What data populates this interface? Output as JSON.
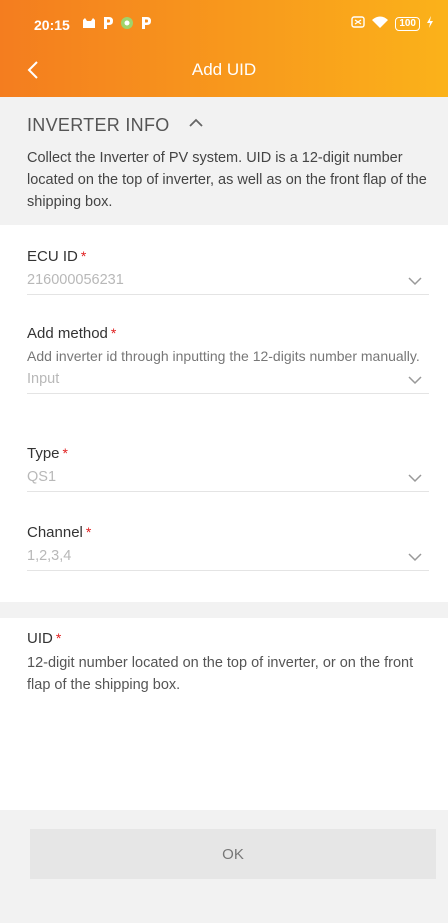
{
  "status_bar": {
    "time": "20:15",
    "left_icons": [
      "cat-icon",
      "p-icon",
      "circle-icon",
      "p-icon"
    ],
    "battery": "100"
  },
  "nav": {
    "title": "Add UID",
    "back_icon": "chevron-left-icon"
  },
  "inverter_info": {
    "title": "INVERTER INFO",
    "toggle_icon": "chevron-up-icon",
    "description": "Collect the Inverter of PV system. UID is a 12-digit number located on the top of inverter, as well as on the front flap of the shipping box."
  },
  "fields": {
    "ecu_id": {
      "label": "ECU ID",
      "required": "*",
      "value": "216000056231"
    },
    "add_method": {
      "label": "Add method",
      "required": "*",
      "hint": "Add inverter id through inputting the 12-digits number manually.",
      "value": "Input"
    },
    "type": {
      "label": "Type",
      "required": "*",
      "value": "QS1"
    },
    "channel": {
      "label": "Channel",
      "required": "*",
      "value": "1,2,3,4"
    },
    "uid": {
      "label": "UID",
      "required": "*",
      "hint": "12-digit number located on the top of inverter, or on the front flap of the shipping box."
    }
  },
  "footer": {
    "ok_label": "OK"
  },
  "colors": {
    "header_gradient_start": "#f47d1f",
    "header_gradient_end": "#fbb21a",
    "required": "#e02020",
    "section_background": "#f2f2f2"
  }
}
